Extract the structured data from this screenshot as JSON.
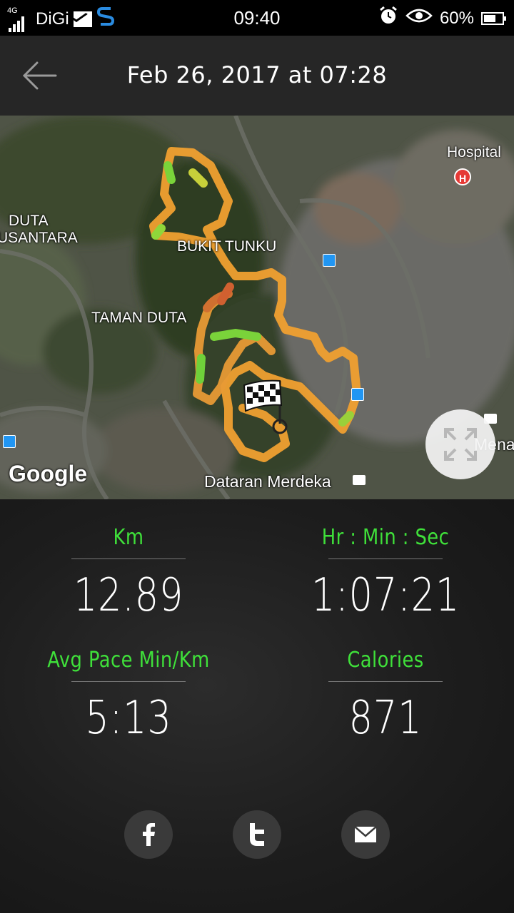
{
  "status_bar": {
    "network": "4G",
    "carrier": "DiGi",
    "time": "09:40",
    "battery": "60%"
  },
  "header": {
    "title": "Feb 26, 2017 at 07:28"
  },
  "map": {
    "labels": {
      "hospital": "Hospital",
      "duta": "DUTA",
      "nusantara": "USANTARA",
      "bukit_tunku": "BUKIT TUNKU",
      "taman_duta": "TAMAN DUTA",
      "dataran_merdeka": "Dataran Merdeka",
      "mena": "Mena"
    },
    "attribution": "Google",
    "hospital_pin": "H"
  },
  "stats": {
    "distance": {
      "label": "Km",
      "value": "12.89"
    },
    "duration": {
      "label": "Hr : Min : Sec",
      "value": "1:07:21"
    },
    "pace": {
      "label": "Avg Pace Min/Km",
      "value": "5:13"
    },
    "calories": {
      "label": "Calories",
      "value": "871"
    }
  },
  "colors": {
    "accent_green": "#3fe03a",
    "route_orange": "#f0a030",
    "route_green": "#7ad33a"
  },
  "icons": [
    "back-arrow-icon",
    "expand-icon",
    "facebook-icon",
    "twitter-icon",
    "mail-icon"
  ]
}
